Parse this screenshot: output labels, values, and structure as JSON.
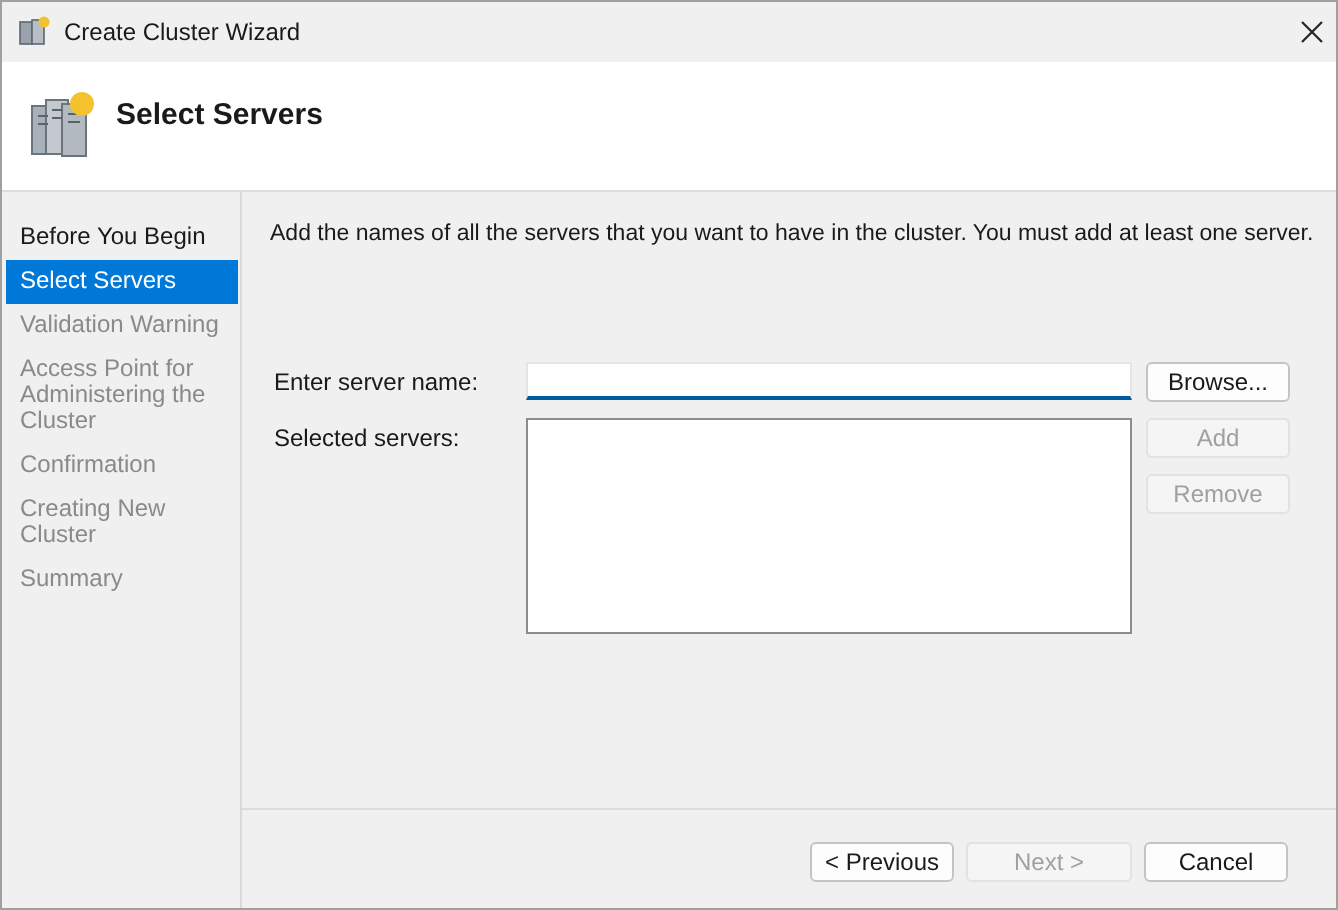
{
  "window": {
    "title": "Create Cluster Wizard"
  },
  "header": {
    "title": "Select Servers"
  },
  "steps": [
    {
      "label": "Before You Begin",
      "selected": false,
      "disabled": false
    },
    {
      "label": "Select Servers",
      "selected": true,
      "disabled": false
    },
    {
      "label": "Validation Warning",
      "selected": false,
      "disabled": true
    },
    {
      "label": "Access Point for Administering the Cluster",
      "selected": false,
      "disabled": true
    },
    {
      "label": "Confirmation",
      "selected": false,
      "disabled": true
    },
    {
      "label": "Creating New Cluster",
      "selected": false,
      "disabled": true
    },
    {
      "label": "Summary",
      "selected": false,
      "disabled": true
    }
  ],
  "instruction": "Add the names of all the servers that you want to have in the cluster. You must add at least one server.",
  "server_name": {
    "label": "Enter server name:",
    "browse_button": "Browse..."
  },
  "selected_servers": {
    "label": "Selected servers:",
    "add_button": {
      "label": "Add",
      "disabled": true
    },
    "remove_button": {
      "label": "Remove",
      "disabled": true
    }
  },
  "footer_buttons": [
    {
      "label": "< Previous",
      "disabled": false
    },
    {
      "label": "Next >",
      "disabled": true
    },
    {
      "label": "Cancel",
      "disabled": false
    }
  ]
}
